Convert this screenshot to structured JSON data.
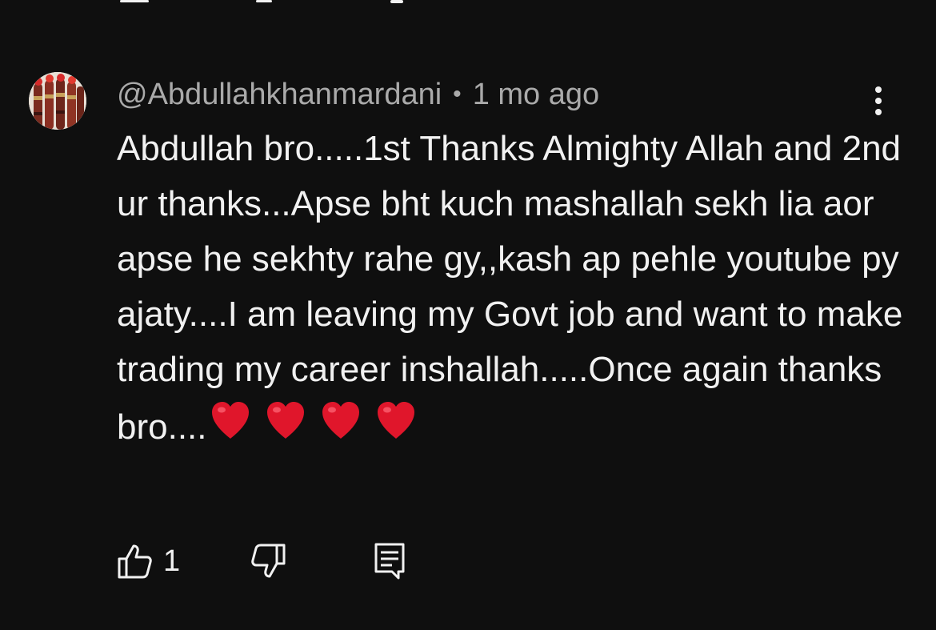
{
  "comment": {
    "author": "@Abdullahkhanmardani",
    "separator": "•",
    "time_ago": "1 mo ago",
    "text": "Abdullah bro.....1st Thanks Almighty Allah and 2nd ur thanks...Apse bht kuch mashallah sekh lia aor apse he sekhty rahe gy,,kash ap pehle youtube py ajaty....I am leaving my Govt job and want to make trading my career inshallah.....Once again thanks bro....",
    "emoji": "❤️❤️❤️❤️",
    "like_count": "1"
  },
  "icons": {
    "avatar": "avatar-image",
    "more": "more-vertical-icon",
    "like": "thumbs-up-icon",
    "dislike": "thumbs-down-icon",
    "reply": "comment-reply-icon",
    "heart": "red-heart-emoji"
  },
  "colors": {
    "background": "#0f0f0f",
    "primary_text": "#f1f1f1",
    "secondary_text": "#aaaaaa",
    "heart": "#e0162b"
  }
}
